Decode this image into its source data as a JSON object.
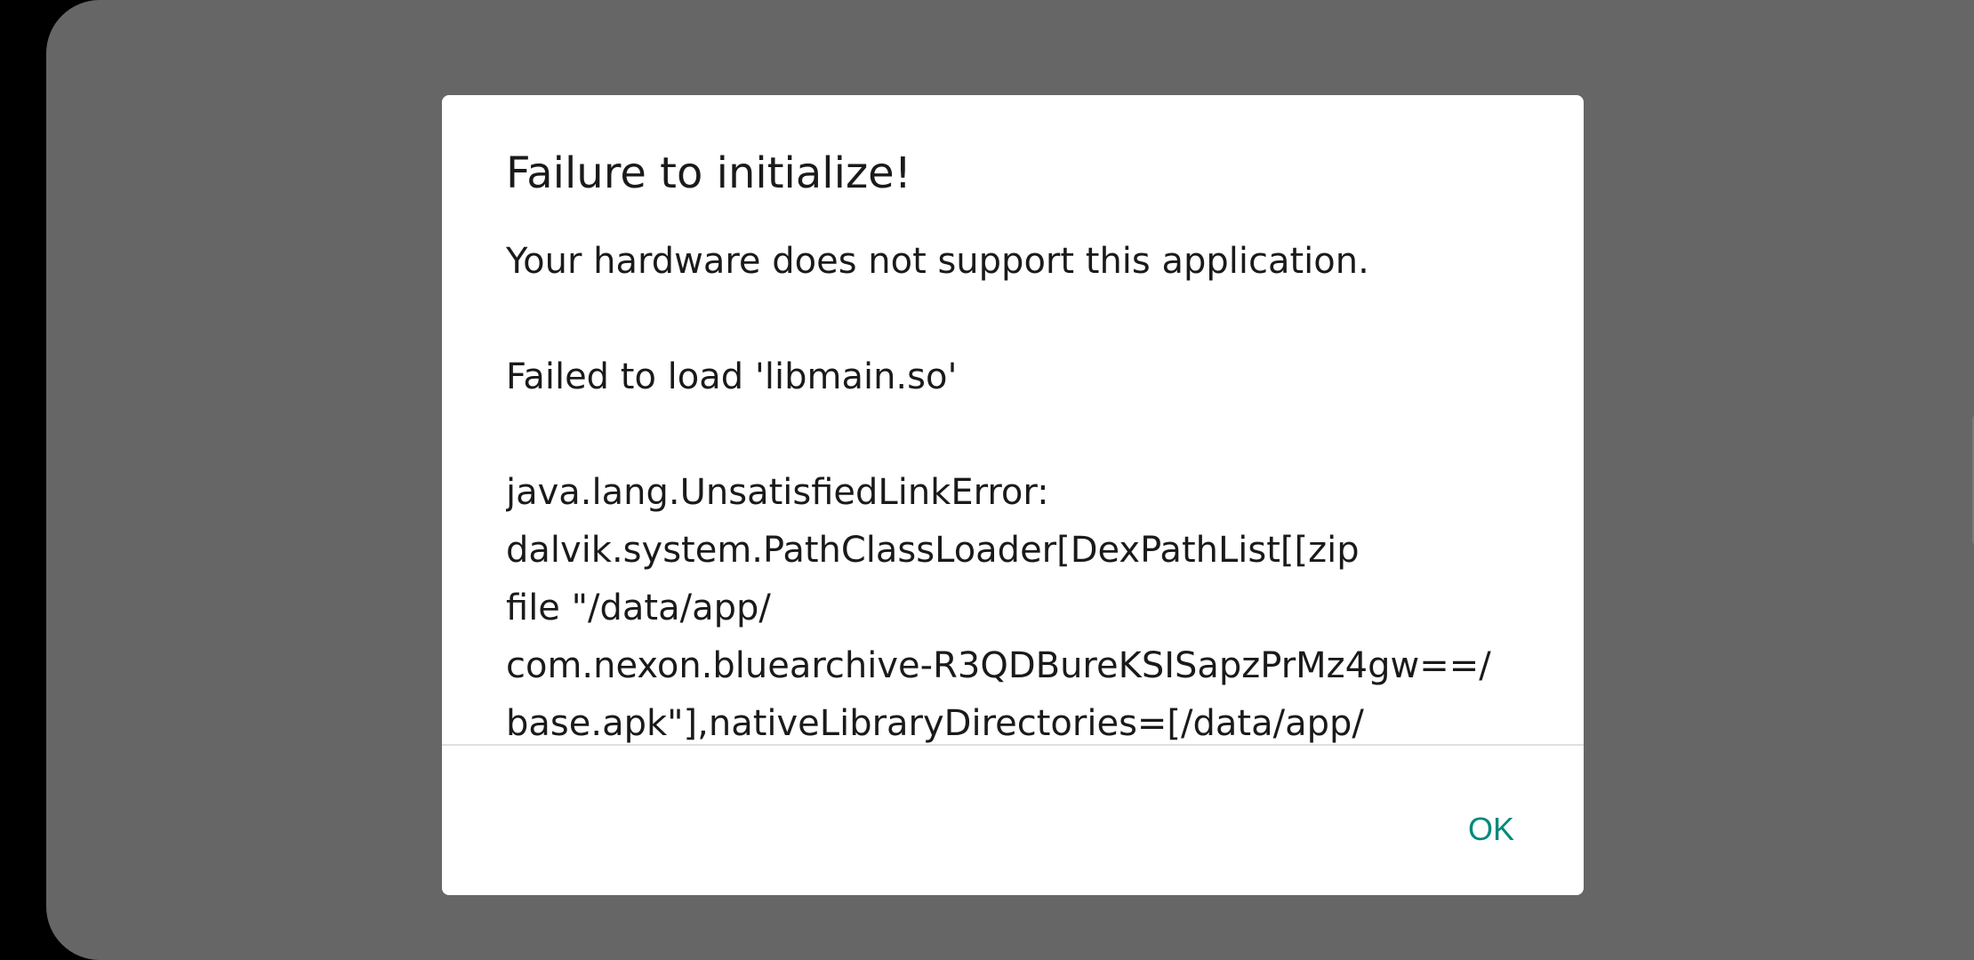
{
  "dialog": {
    "title": "Failure to initialize!",
    "message": "Your hardware does not support this application.\n\nFailed to load 'libmain.so'\n\njava.lang.UnsatisfiedLinkError:\ndalvik.system.PathClassLoader[DexPathList[[zip\nfile \"/data/app/\ncom.nexon.bluearchive-R3QDBureKSISapzPrMz4gw==/\nbase.apk\"],nativeLibraryDirectories=[/data/app/",
    "ok_label": "OK"
  },
  "colors": {
    "overlay": "#666666",
    "dialog_background": "#ffffff",
    "button_accent": "#00897b",
    "text": "#1a1a1a"
  }
}
